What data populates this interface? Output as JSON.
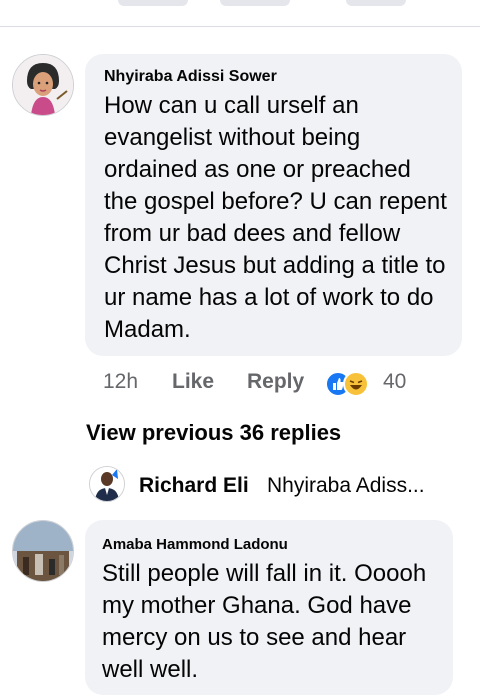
{
  "comments": [
    {
      "author": "Nhyiraba Adissi Sower",
      "text": "How can u call urself an evangelist without being ordained as one or preached the gospel before? U can repent from ur bad dees and fellow Christ Jesus but adding a title to ur name has a lot of work to do Madam.",
      "time": "12h",
      "like_label": "Like",
      "reply_label": "Reply",
      "reaction_count": "40",
      "reaction_icons": [
        "like-icon",
        "haha-icon"
      ]
    },
    {
      "author": "Amaba Hammond Ladonu",
      "text": "Still people will fall in it. Ooooh my mother Ghana. God have mercy on us to see and hear well well."
    }
  ],
  "view_previous_label": "View previous 36 replies",
  "reply_preview": {
    "author": "Richard Eli",
    "snippet": "Nhyiraba Adiss..."
  },
  "colors": {
    "bubble": "#f0f2f5",
    "secondary_text": "#65676b",
    "like_blue": "#1877f2",
    "haha_yellow": "#f7c23a"
  }
}
